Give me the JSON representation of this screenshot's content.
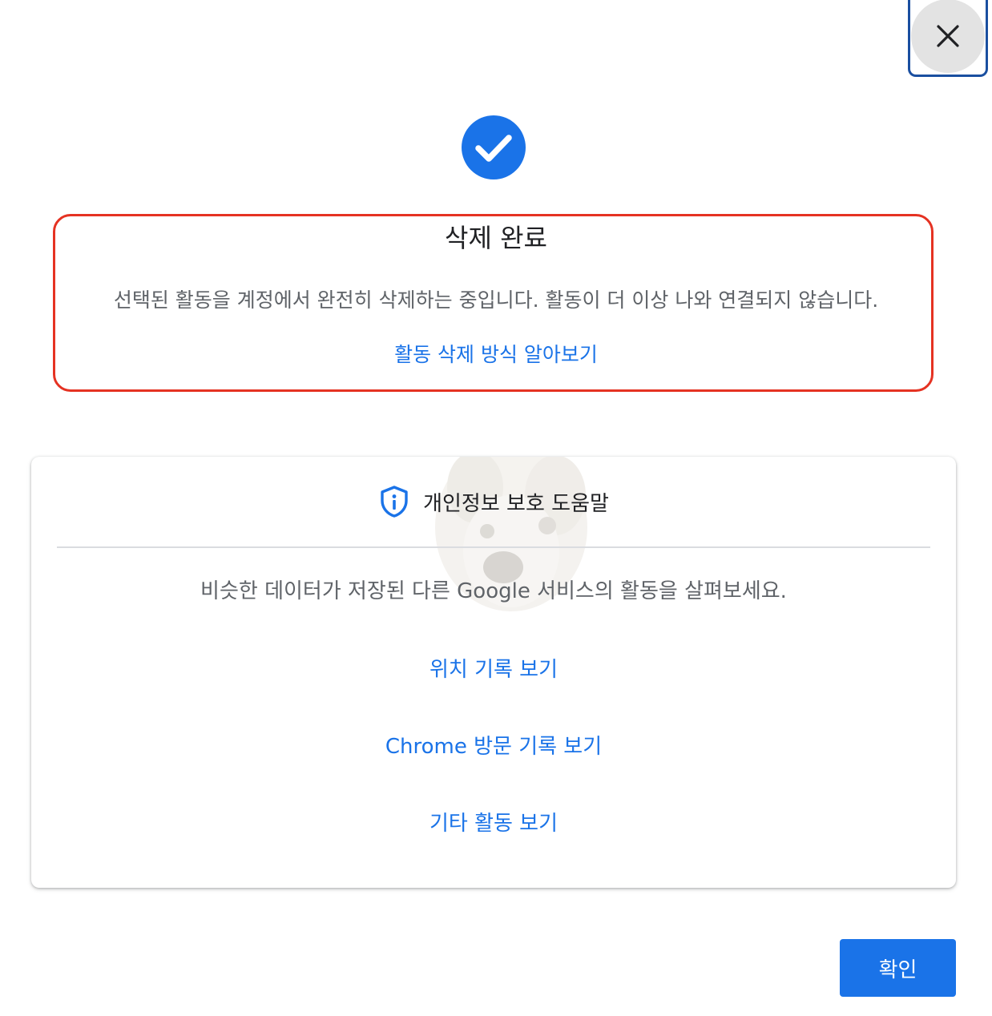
{
  "dialog": {
    "close_icon": "close-icon",
    "status_icon": "check-circle-icon",
    "title": "삭제 완료",
    "description": "선택된 활동을 계정에서 완전히 삭제하는 중입니다. 활동이 더 이상 나와 연결되지 않습니다.",
    "learn_more_link": "활동 삭제 방식 알아보기",
    "highlight_color": "#e53222"
  },
  "privacy_card": {
    "icon": "shield-info-icon",
    "heading": "개인정보 보호 도움말",
    "text": "비슷한 데이터가 저장된 다른 Google 서비스의 활동을 살펴보세요.",
    "links": [
      "위치 기록 보기",
      "Chrome 방문 기록 보기",
      "기타 활동 보기"
    ]
  },
  "footer": {
    "confirm_label": "확인"
  },
  "colors": {
    "accent": "#1a73e8",
    "text_secondary": "#5f6368"
  }
}
